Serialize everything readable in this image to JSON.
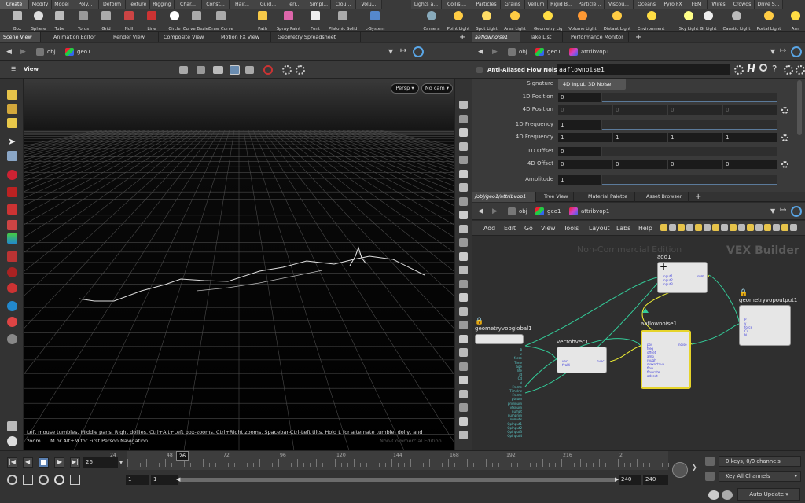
{
  "shelf": {
    "left_tabs": [
      "Create",
      "Modify",
      "Model",
      "Poly...",
      "Deform",
      "Texture",
      "Rigging",
      "Char...",
      "Const...",
      "Hair...",
      "Guid...",
      "Terr...",
      "Simpl...",
      "Clou...",
      "Volu..."
    ],
    "right_tabs": [
      "Lights a...",
      "Collisi...",
      "Particles",
      "Grains",
      "Vellum",
      "Rigid B...",
      "Particle...",
      "Viscou...",
      "Oceans",
      "Pyro FX",
      "FEM",
      "Wires",
      "Crowds",
      "Drive S..."
    ],
    "left_tools": [
      "Box",
      "Sphere",
      "Tube",
      "Torus",
      "Grid",
      "Null",
      "Line",
      "Circle",
      "Curve Bezier",
      "Draw Curve",
      "Path",
      "Spray Paint",
      "Font",
      "Platonic Solids",
      "L-System"
    ],
    "right_tools": [
      "Camera",
      "Point Light",
      "Spot Light",
      "Area Light",
      "Geometry Light",
      "Volume Light",
      "Distant Light",
      "Environment Light",
      "Sky Light",
      "GI Light",
      "Caustic Light",
      "Portal Light",
      "Aml"
    ]
  },
  "left_pane": {
    "tabs": [
      "Scene View",
      "Animation Editor",
      "Render View",
      "Composite View",
      "Motion FX View",
      "Geometry Spreadsheet"
    ],
    "path": [
      "obj",
      "geo1"
    ],
    "view_label": "View",
    "persp_button": "Persp",
    "cam_button": "No cam",
    "hint_line1": "Left mouse tumbles. Middle pans. Right dollies. Ctrl+Alt+Left box-zooms. Ctrl+Right zooms. Spacebar-Ctrl-Left tilts. Hold L for alternate tumble, dolly, and",
    "hint_line2": "zoom.     M or Alt+M for First Person Navigation.",
    "watermark": "Non-Commercial Edition"
  },
  "params": {
    "tabs": [
      "aaflownoise1",
      "Take List",
      "Performance Monitor"
    ],
    "path": [
      "obj",
      "geo1",
      "attribvop1"
    ],
    "node_type": "Anti-Aliased Flow Noise",
    "node_name": "aaflownoise1",
    "signature_label": "Signature",
    "signature_value": "4D Input, 3D Noise",
    "rows": [
      {
        "label": "1D Position",
        "values": [
          "0"
        ]
      },
      {
        "label": "4D Position",
        "values": [
          "0",
          "0",
          "0",
          "0"
        ]
      },
      {
        "label": "1D Frequency",
        "values": [
          "1"
        ]
      },
      {
        "label": "4D Frequency",
        "values": [
          "1",
          "1",
          "1",
          "1"
        ]
      },
      {
        "label": "1D Offset",
        "values": [
          "0"
        ]
      },
      {
        "label": "4D Offset",
        "values": [
          "0",
          "0",
          "0",
          "0"
        ]
      },
      {
        "label": "Amplitude",
        "values": [
          "1"
        ]
      }
    ]
  },
  "network": {
    "tabs": [
      "/obj/geo1/attribvop1",
      "Tree View",
      "Material Palette",
      "Asset Browser"
    ],
    "path": [
      "obj",
      "geo1",
      "attribvop1"
    ],
    "menu": [
      "Add",
      "Edit",
      "Go",
      "View",
      "Tools",
      "Layout",
      "Labs",
      "Help"
    ],
    "watermark": "Non-Commercial Edition",
    "builder": "VEX Builder",
    "nodes": {
      "add1": {
        "name": "add1",
        "ports": [
          "input1",
          "input2",
          "input3"
        ],
        "out": "sum"
      },
      "global": {
        "name": "geometryvopglobal1",
        "ports": "P\nv\nforce\nTime\nage\nlife\nid\nCd\nN\nFrame\nTimeInc\nFrame\nptnum\nprimnum\nvtxnum\nnumpt\nnumprim\nnumvtx\nOpInput1\nOpInput2\nOpInput3\nOpInput4"
      },
      "vec": {
        "name": "vectohvec1",
        "ports": [
          "vec",
          "fval4"
        ],
        "out": "hvec"
      },
      "flow": {
        "name": "aaflownoise1",
        "ports": [
          "pos",
          "freq",
          "offset",
          "amp",
          "rough",
          "maxoctave",
          "flow",
          "flowrate",
          "advect"
        ],
        "out": "noise"
      },
      "output": {
        "name": "geometryvopoutput1",
        "ports": [
          "P",
          "v",
          "force",
          "Cd",
          "N"
        ]
      }
    }
  },
  "timeline": {
    "frame_value": "26",
    "ruler": [
      "24",
      "48",
      "72",
      "96",
      "120",
      "144",
      "168",
      "192",
      "216",
      "2"
    ],
    "current_marker": "26",
    "start": "1",
    "start2": "1",
    "end": "240",
    "end2": "240",
    "keys_status": "0 keys, 0/0 channels",
    "key_channels": "Key All Channels",
    "auto_update": "Auto Update"
  }
}
